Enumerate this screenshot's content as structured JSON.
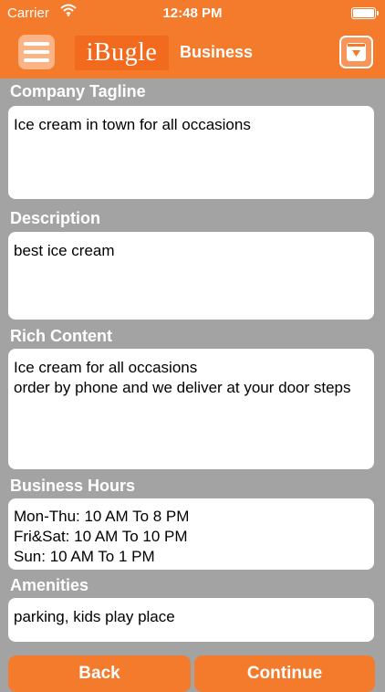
{
  "status_bar": {
    "carrier": "Carrier",
    "time": "12:48 PM"
  },
  "nav": {
    "logo_text": "iBugle",
    "title": "Business"
  },
  "form": {
    "tagline_label": "Company Tagline",
    "tagline_value": "Ice cream in town for all occasions",
    "description_label": "Description",
    "description_value": "best ice cream",
    "rich_content_label": "Rich Content",
    "rich_content_value": "Ice cream for all occasions\norder by phone and we deliver at your door steps",
    "hours_label": "Business Hours",
    "hours_value": "Mon-Thu: 10 AM To 8 PM\nFri&Sat: 10 AM To 10 PM\nSun: 10 AM To 1 PM",
    "amenities_label": "Amenities",
    "amenities_value": "parking, kids play place"
  },
  "buttons": {
    "back": "Back",
    "continue": "Continue"
  },
  "colors": {
    "accent": "#f47a2c",
    "background": "#a3a3a3"
  }
}
